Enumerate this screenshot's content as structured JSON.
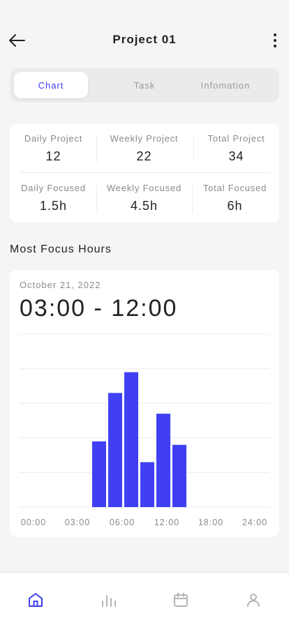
{
  "header": {
    "title": "Project 01"
  },
  "tabs": [
    {
      "label": "Chart",
      "active": true
    },
    {
      "label": "Task",
      "active": false
    },
    {
      "label": "Infomation",
      "active": false
    }
  ],
  "stats": {
    "row1": [
      {
        "label": "Daily Project",
        "value": "12"
      },
      {
        "label": "Weekly Project",
        "value": "22"
      },
      {
        "label": "Total Project",
        "value": "34"
      }
    ],
    "row2": [
      {
        "label": "Daily Focused",
        "value": "1.5h"
      },
      {
        "label": "Weekly Focused",
        "value": "4.5h"
      },
      {
        "label": "Total Focused",
        "value": "6h"
      }
    ]
  },
  "section": {
    "title": "Most Focus Hours"
  },
  "chart_card": {
    "date": "October 21, 2022",
    "range": "03:00 - 12:00"
  },
  "colors": {
    "accent": "#3d3df0",
    "bar": "#4040f2",
    "inactive": "#b5b5b5"
  },
  "nav": [
    {
      "icon": "home-icon",
      "active": true
    },
    {
      "icon": "bar-chart-icon",
      "active": false
    },
    {
      "icon": "calendar-icon",
      "active": false
    },
    {
      "icon": "profile-icon",
      "active": false
    }
  ],
  "chart_data": {
    "type": "bar",
    "x_tick_labels": [
      "00:00",
      "03:00",
      "06:00",
      "12:00",
      "18:00",
      "24:00"
    ],
    "bars": [
      {
        "hour": 4,
        "value": 1.9
      },
      {
        "hour": 5,
        "value": 3.3
      },
      {
        "hour": 6,
        "value": 3.9
      },
      {
        "hour": 7,
        "value": 1.3
      },
      {
        "hour": 8,
        "value": 2.7
      },
      {
        "hour": 9,
        "value": 1.8
      }
    ],
    "ylim": [
      0,
      5
    ],
    "grid": true,
    "title": "",
    "xlabel": "",
    "ylabel": ""
  }
}
